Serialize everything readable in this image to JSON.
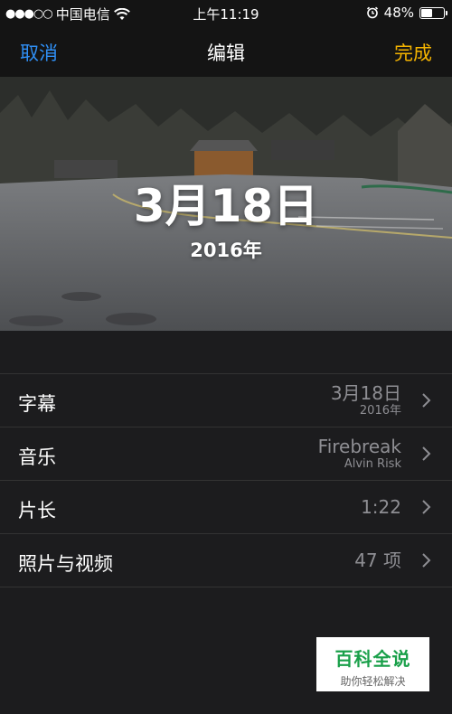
{
  "status_bar": {
    "signal": "●●●○○",
    "carrier": "中国电信",
    "time": "上午11:19",
    "battery_text": "48%",
    "battery_level": 0.48
  },
  "nav": {
    "cancel_label": "取消",
    "title": "编辑",
    "done_label": "完成"
  },
  "preview": {
    "date": "3月18日",
    "year": "2016年"
  },
  "rows": [
    {
      "label": "字幕",
      "value": "3月18日",
      "subvalue": "2016年"
    },
    {
      "label": "音乐",
      "value": "Firebreak",
      "subvalue": "Alvin Risk"
    },
    {
      "label": "片长",
      "value": "1:22",
      "subvalue": ""
    },
    {
      "label": "照片与视频",
      "value": "47 项",
      "subvalue": ""
    }
  ],
  "watermark": {
    "title": "百科全说",
    "subtitle": "助你轻松解决"
  },
  "colors": {
    "cancel": "#2f8ff5",
    "done": "#f5b400",
    "background": "#1c1c1e",
    "watermark_green": "#1aa04a"
  }
}
